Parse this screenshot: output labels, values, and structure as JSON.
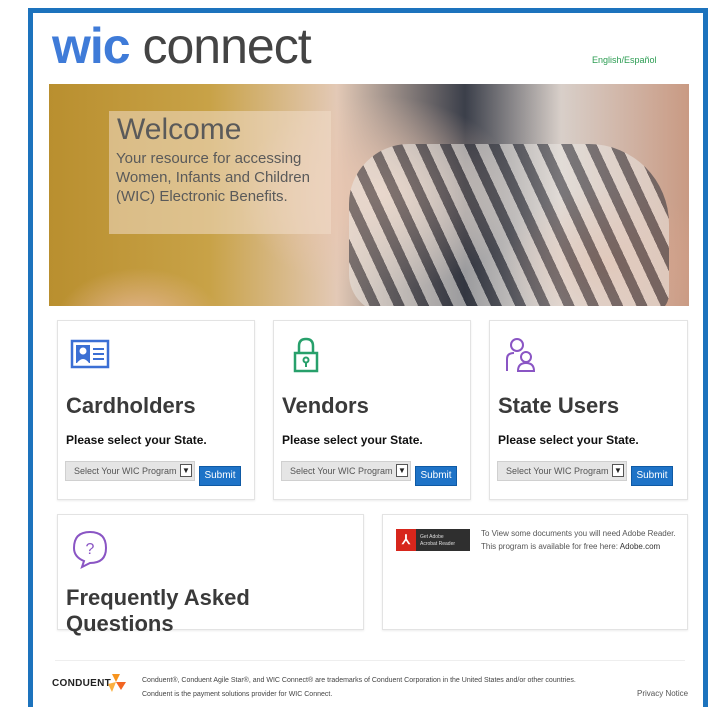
{
  "header": {
    "logo_wic": "wic",
    "logo_connect": "connect",
    "language_link": "English/Español"
  },
  "hero": {
    "title": "Welcome",
    "text": "Your resource for accessing Women, Infants and Children (WIC) Electronic Benefits."
  },
  "cards": {
    "cardholders": {
      "title": "Cardholders",
      "prompt": "Please select your State.",
      "select_value": "Select Your WIC Program",
      "submit_label": "Submit"
    },
    "vendors": {
      "title": "Vendors",
      "prompt": "Please select your State.",
      "select_value": "Select Your WIC Program",
      "submit_label": "Submit"
    },
    "state_users": {
      "title": "State Users",
      "prompt": "Please select your State.",
      "select_value": "Select Your WIC Program",
      "submit_label": "Submit"
    }
  },
  "faq": {
    "title": "Frequently Asked Questions"
  },
  "adobe": {
    "badge_line1": "Get Adobe",
    "badge_line2": "Acrobat Reader",
    "text": "To View some documents you will need Adobe Reader. This program is available for free here:",
    "link": "Adobe.com"
  },
  "footer": {
    "logo_text": "CONDUENT",
    "line1": "Conduent®, Conduent Agile Star®, and WIC Connect® are trademarks of Conduent Corporation in the United States and/or other countries.",
    "line2": "Conduent is the payment solutions provider for WIC Connect.",
    "privacy": "Privacy Notice"
  },
  "colors": {
    "frame_blue": "#1d73bd",
    "submit_blue": "#1e73c7",
    "icon_blue": "#3b6fd4",
    "icon_green": "#27a06b",
    "icon_purple": "#8a55c4"
  }
}
